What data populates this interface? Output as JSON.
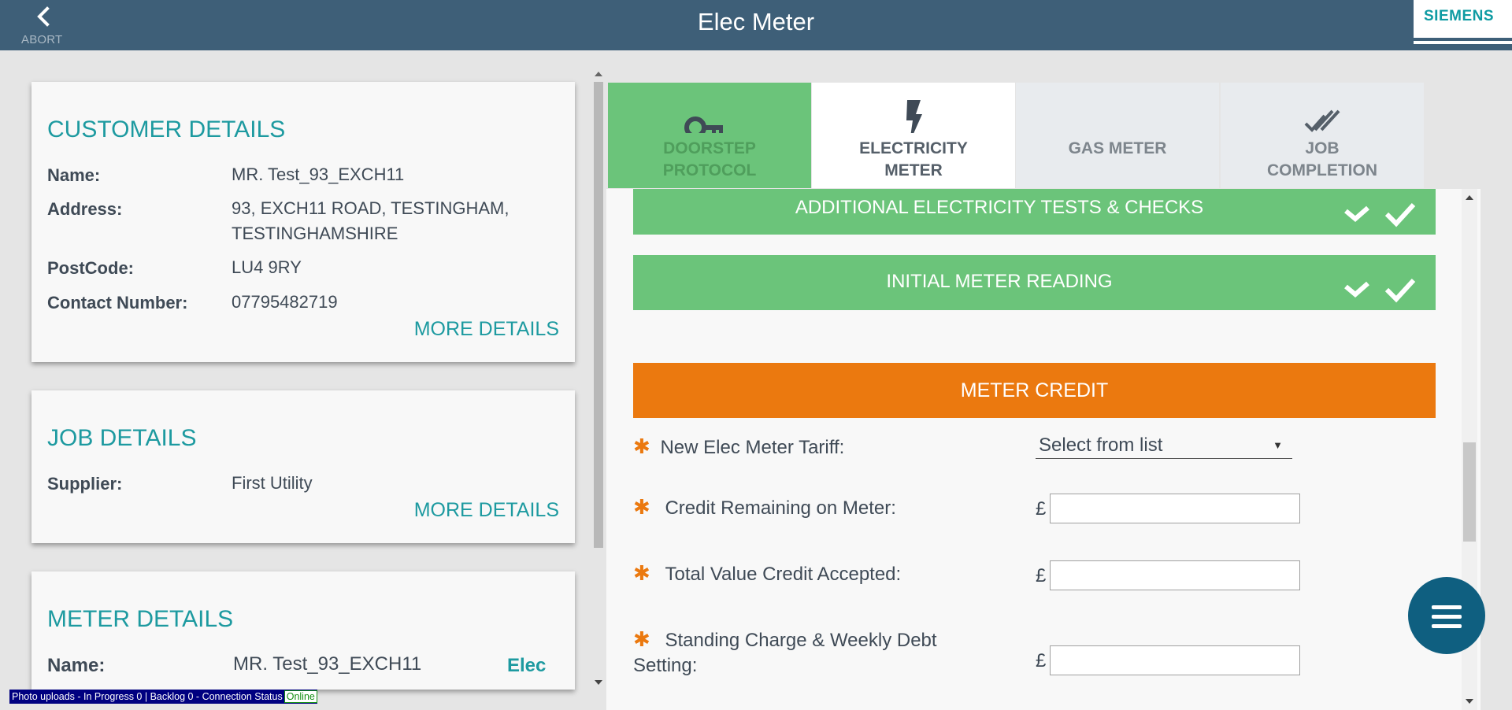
{
  "header": {
    "abort_label": "ABORT",
    "title": "Elec Meter",
    "brand": "SIEMENS"
  },
  "customer_card": {
    "title": "CUSTOMER DETAILS",
    "rows": [
      {
        "label": "Name:",
        "value": "MR. Test_93_EXCH11"
      },
      {
        "label": "Address:",
        "value": "93, EXCH11 ROAD, TESTINGHAM, TESTINGHAMSHIRE"
      },
      {
        "label": "PostCode:",
        "value": "LU4 9RY"
      },
      {
        "label": "Contact Number:",
        "value": "07795482719"
      }
    ],
    "more_label": "MORE DETAILS"
  },
  "job_card": {
    "title": "JOB DETAILS",
    "rows": [
      {
        "label": "Supplier:",
        "value": "First Utility"
      }
    ],
    "more_label": "MORE DETAILS"
  },
  "meter_card": {
    "title": "METER DETAILS",
    "rows": [
      {
        "label": "Name:",
        "value": "MR. Test_93_EXCH11",
        "badge": "Elec"
      }
    ]
  },
  "tabs": [
    {
      "label_line1": "DOORSTEP",
      "label_line2": "PROTOCOL",
      "icon": "key-icon",
      "state": "completed"
    },
    {
      "label_line1": "ELECTRICITY",
      "label_line2": "METER",
      "icon": "lightning-icon",
      "state": "active"
    },
    {
      "label_line1": "GAS METER",
      "label_line2": "",
      "icon": "",
      "state": "inactive"
    },
    {
      "label_line1": "JOB",
      "label_line2": "COMPLETION",
      "icon": "double-check-icon",
      "state": "inactive"
    }
  ],
  "sections": {
    "additional_tests": "ADDITIONAL ELECTRICITY TESTS & CHECKS",
    "initial_reading": "INITIAL METER READING",
    "meter_credit": "METER CREDIT"
  },
  "form": {
    "tariff_label": "New Elec Meter Tariff:",
    "tariff_selected": "Select from list",
    "credit_remaining_label": "Credit Remaining on Meter:",
    "credit_accepted_label": "Total Value Credit Accepted:",
    "standing_charge_label_line1": "Standing Charge & Weekly Debt",
    "standing_charge_label_line2": "Setting:",
    "currency": "£",
    "required_marker": "✱"
  },
  "status_bar": {
    "text": "Photo uploads - In Progress 0 | Backlog 0 - Connection Status",
    "connection": "Online"
  },
  "colors": {
    "header": "#3e5f78",
    "teal": "#1d9aa0",
    "green": "#6bc47a",
    "orange": "#eb790f",
    "fab": "#0f5f80"
  }
}
